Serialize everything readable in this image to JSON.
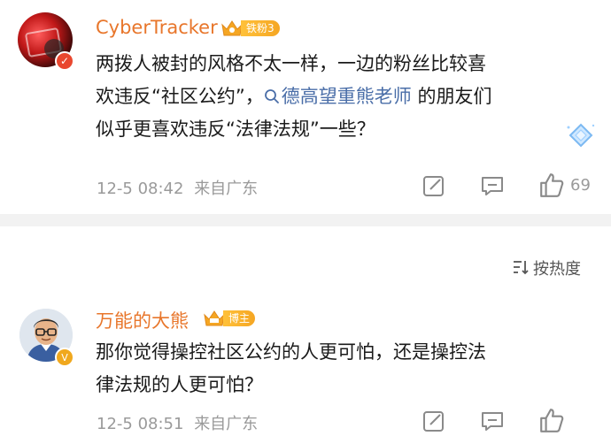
{
  "comments": [
    {
      "username": "CyberTracker",
      "badge_label": "铁粉3",
      "text_parts": {
        "line1": "两拨人被封的风格不太一样，一边的粉丝比较喜",
        "line2_before": "欢违反“社区公约”，",
        "mention": "德高望重熊老师",
        "line2_after": " 的朋友们",
        "line3": "似乎更喜欢违反“法律法规”一些？"
      },
      "time": "12-5 08:42",
      "location": "来自广东",
      "like_count": "69",
      "icons": [
        "share-icon",
        "reply-icon",
        "like-icon",
        "diamond-icon"
      ]
    },
    {
      "username": "万能的大熊",
      "badge_label": "博主",
      "text_parts": {
        "line1": "那你觉得操控社区公约的人更可怕，还是操控法",
        "line2": "律法规的人更可怕？"
      },
      "time": "12-5 08:51",
      "location": "来自广东",
      "icons": [
        "share-icon",
        "reply-icon",
        "like-icon"
      ]
    }
  ],
  "sort": {
    "label": "按热度",
    "icon": "sort-icon"
  },
  "colors": {
    "username": "#e8762b",
    "mention": "#4a6ea8",
    "meta": "#9a9a9a",
    "divider": "#f2f2f2",
    "badge_gold": "#f5a623"
  }
}
